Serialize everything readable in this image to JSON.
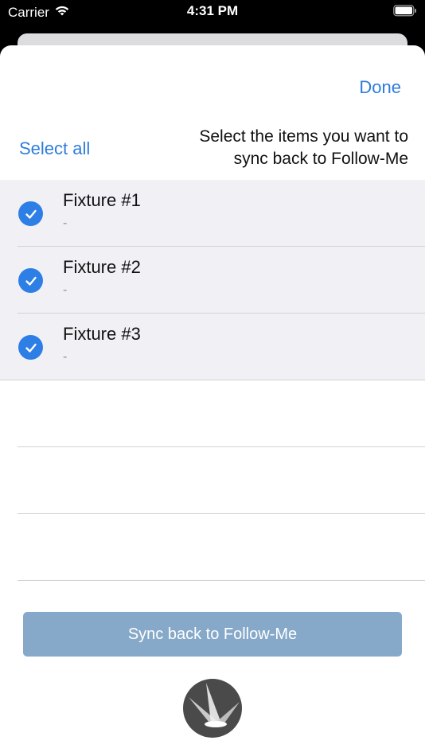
{
  "status_bar": {
    "carrier": "Carrier",
    "time": "4:31 PM"
  },
  "header": {
    "done_label": "Done",
    "select_all_label": "Select all",
    "instructions": "Select the items you want to sync back to Follow-Me"
  },
  "items": [
    {
      "title": "Fixture #1",
      "subtitle": "-",
      "selected": true
    },
    {
      "title": "Fixture #2",
      "subtitle": "-",
      "selected": true
    },
    {
      "title": "Fixture #3",
      "subtitle": "-",
      "selected": true
    }
  ],
  "sync_button": {
    "label": "Sync back to Follow-Me"
  },
  "colors": {
    "accent": "#2f7cdc",
    "check": "#2d7fe6",
    "selected_row": "#f0f0f5",
    "sync_button": "#86a9c9"
  },
  "icons": {
    "wifi": "wifi-icon",
    "battery": "battery-icon",
    "checkmark": "checkmark-circle-icon",
    "logo": "follow-me-spotlight-logo"
  }
}
